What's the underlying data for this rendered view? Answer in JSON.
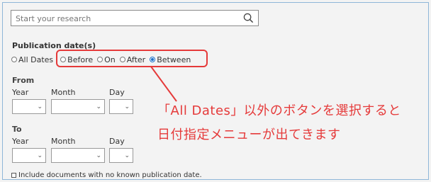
{
  "search": {
    "placeholder": "Start your research"
  },
  "publication": {
    "title": "Publication date(s)",
    "options": [
      {
        "label": "All Dates",
        "checked": false
      },
      {
        "label": "Before",
        "checked": false
      },
      {
        "label": "On",
        "checked": false
      },
      {
        "label": "After",
        "checked": false
      },
      {
        "label": "Between",
        "checked": true
      }
    ]
  },
  "from": {
    "heading": "From",
    "year_label": "Year",
    "month_label": "Month",
    "day_label": "Day"
  },
  "to": {
    "heading": "To",
    "year_label": "Year",
    "month_label": "Month",
    "day_label": "Day"
  },
  "annotation": {
    "line1": "「All Dates」以外のボタンを選択すると",
    "line2": "日付指定メニューが出てきます"
  },
  "include_unknown": {
    "label": "Include documents with no known publication date.",
    "checked": false
  },
  "colors": {
    "accent": "#e53a3a",
    "radio_checked": "#1a6fc9"
  }
}
